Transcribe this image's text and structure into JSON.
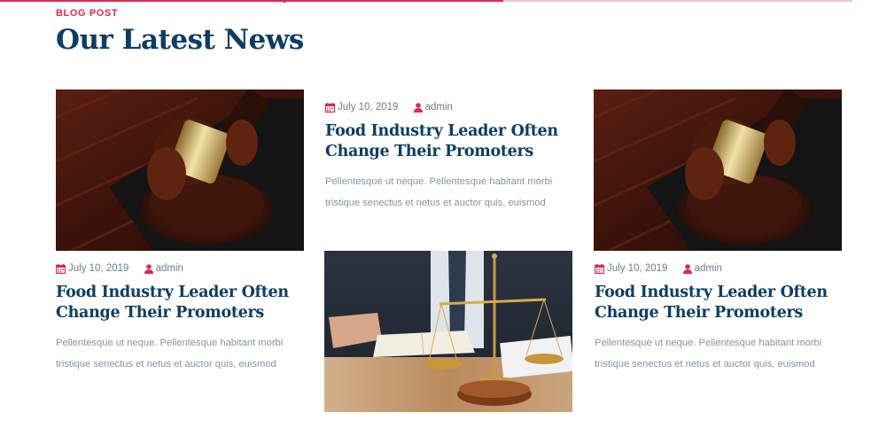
{
  "section": {
    "eyebrow": "BLOG POST",
    "title": "Our Latest News"
  },
  "posts": [
    {
      "image": "judge-gavel-photo",
      "date": "July 10, 2019",
      "author": "admin",
      "title": "Food Industry Leader Often Change Their Promoters",
      "excerpt": "Pellentesque ut neque. Pellentesque habitant morbi tristique senectus et netus et auctor quis, euismod"
    },
    {
      "image": "scales-of-justice-photo",
      "date": "July 10, 2019",
      "author": "admin",
      "title": "Food Industry Leader Often Change Their Promoters",
      "excerpt": "Pellentesque ut neque. Pellentesque habitant morbi tristique senectus et netus et auctor quis, euismod"
    },
    {
      "image": "judge-gavel-photo",
      "date": "July 10, 2019",
      "author": "admin",
      "title": "Food Industry Leader Often Change Their Promoters",
      "excerpt": "Pellentesque ut neque. Pellentesque habitant morbi tristique senectus et netus et auctor quis, euismod"
    }
  ],
  "icons": {
    "calendar": "calendar-icon",
    "user": "user-icon"
  },
  "colors": {
    "accent": "#e0284f",
    "heading": "#0e3d63",
    "body_text": "#8594a2"
  }
}
